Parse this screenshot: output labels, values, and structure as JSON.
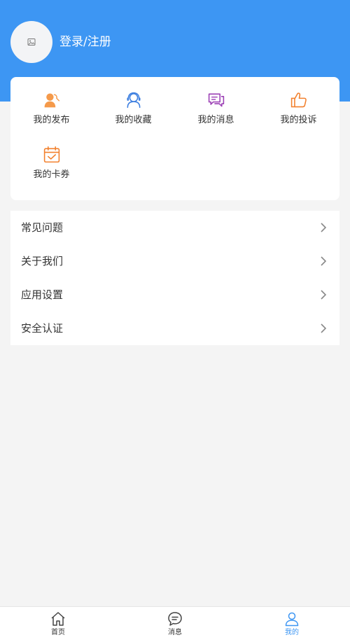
{
  "header": {
    "login_label": "登录/注册",
    "avatar_icon": "image-placeholder-icon",
    "background_color": "#3d96f3"
  },
  "quick_actions": [
    {
      "label": "我的发布",
      "icon": "user-publish-icon",
      "color": "#f59a4a"
    },
    {
      "label": "我的收藏",
      "icon": "collect-headset-icon",
      "color": "#3d7fe0"
    },
    {
      "label": "我的消息",
      "icon": "message-bubbles-icon",
      "color": "#9b3fb5"
    },
    {
      "label": "我的投诉",
      "icon": "thumbs-up-icon",
      "color": "#f2802d"
    },
    {
      "label": "我的卡券",
      "icon": "calendar-check-icon",
      "color": "#f2802d"
    }
  ],
  "menu": [
    {
      "label": "常见问题"
    },
    {
      "label": "关于我们"
    },
    {
      "label": "应用设置"
    },
    {
      "label": "安全认证"
    }
  ],
  "tabbar": {
    "items": [
      {
        "label": "首页",
        "icon": "home-icon"
      },
      {
        "label": "消息",
        "icon": "chat-icon"
      },
      {
        "label": "我的",
        "icon": "person-icon"
      }
    ],
    "active_index": 2,
    "active_color": "#3d96f3"
  }
}
